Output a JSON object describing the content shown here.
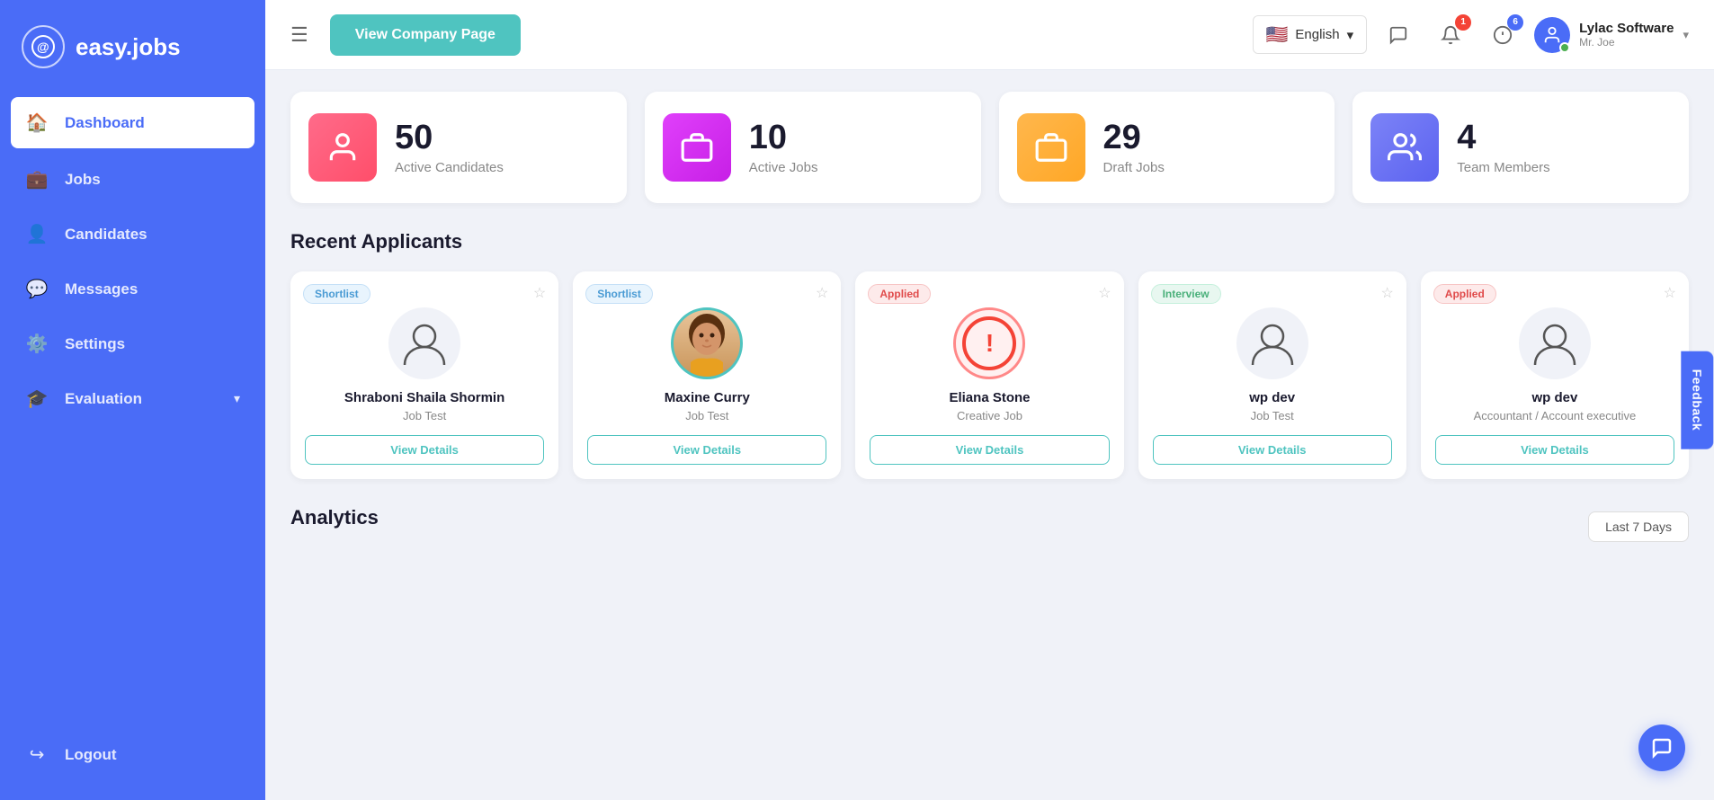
{
  "app": {
    "name": "easy.jobs",
    "logo_symbol": "©"
  },
  "sidebar": {
    "items": [
      {
        "id": "dashboard",
        "label": "Dashboard",
        "icon": "🏠",
        "active": true
      },
      {
        "id": "jobs",
        "label": "Jobs",
        "icon": "💼",
        "active": false
      },
      {
        "id": "candidates",
        "label": "Candidates",
        "icon": "👤",
        "active": false
      },
      {
        "id": "messages",
        "label": "Messages",
        "icon": "💬",
        "active": false
      },
      {
        "id": "settings",
        "label": "Settings",
        "icon": "⚙️",
        "active": false
      },
      {
        "id": "evaluation",
        "label": "Evaluation",
        "icon": "🎓",
        "active": false,
        "has_chevron": true
      }
    ],
    "logout_label": "Logout"
  },
  "topbar": {
    "view_company_label": "View Company Page",
    "language": {
      "selected": "English",
      "flag": "🇺🇸"
    },
    "notifications": {
      "messages_count": "",
      "bell_count": "1",
      "alerts_count": "6"
    },
    "user": {
      "company": "Lylac Software",
      "name": "Mr. Joe"
    }
  },
  "stats": [
    {
      "id": "active-candidates",
      "number": "50",
      "label": "Active Candidates",
      "icon": "👤",
      "color": "pink"
    },
    {
      "id": "active-jobs",
      "number": "10",
      "label": "Active Jobs",
      "icon": "💼",
      "color": "magenta"
    },
    {
      "id": "draft-jobs",
      "number": "29",
      "label": "Draft Jobs",
      "icon": "💼",
      "color": "orange"
    },
    {
      "id": "team-members",
      "number": "4",
      "label": "Team Members",
      "icon": "👥",
      "color": "purple"
    }
  ],
  "recent_applicants": {
    "title": "Recent Applicants",
    "cards": [
      {
        "id": "card-1",
        "badge": "Shortlist",
        "badge_type": "shortlist",
        "name": "Shraboni Shaila Shormin",
        "job": "Job Test",
        "has_photo": false,
        "photo_type": "person",
        "btn_label": "View Details"
      },
      {
        "id": "card-2",
        "badge": "Shortlist",
        "badge_type": "shortlist",
        "name": "Maxine Curry",
        "job": "Job Test",
        "has_photo": true,
        "photo_type": "person_color",
        "btn_label": "View Details"
      },
      {
        "id": "card-3",
        "badge": "Applied",
        "badge_type": "applied",
        "name": "Eliana Stone",
        "job": "Creative Job",
        "has_photo": false,
        "photo_type": "error",
        "btn_label": "View Details"
      },
      {
        "id": "card-4",
        "badge": "Interview",
        "badge_type": "interview",
        "name": "wp dev",
        "job": "Job Test",
        "has_photo": false,
        "photo_type": "person",
        "btn_label": "View Details"
      },
      {
        "id": "card-5",
        "badge": "Applied",
        "badge_type": "applied",
        "name": "wp dev",
        "job": "Accountant / Account executive",
        "has_photo": false,
        "photo_type": "person",
        "btn_label": "View Details"
      }
    ]
  },
  "analytics": {
    "title": "Analytics",
    "period_label": "Last 7 Days"
  },
  "feedback": {
    "label": "Feedback"
  },
  "chat_fab": {
    "icon": "💬"
  }
}
